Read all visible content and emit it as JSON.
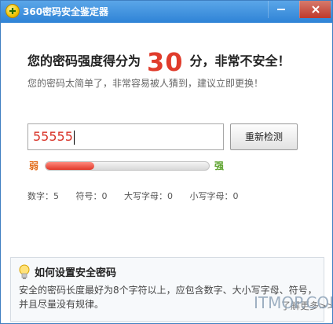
{
  "window": {
    "title": "360密码安全鉴定器"
  },
  "score": {
    "prefix": "您的密码强度得分为",
    "value": "30",
    "suffix": "分，非常不安全！",
    "subtitle": "您的密码太简单了，非常容易被人猜到，建议立即更换！"
  },
  "input": {
    "value": "55555"
  },
  "recheck_button": "重新检测",
  "strength": {
    "weak_label": "弱",
    "strong_label": "强",
    "level": 0.3,
    "fill_color": "#e0382a"
  },
  "stats": [
    {
      "label": "数字：5"
    },
    {
      "label": "符号：0"
    },
    {
      "label": "大写字母：0"
    },
    {
      "label": "小写字母：0"
    }
  ],
  "tip": {
    "title": "如何设置安全密码",
    "body": "安全的密码长度最好为8个字符以上，应包含数字、大小写字母、符号，并且尽量没有规律。",
    "more": "了解更多>>"
  },
  "watermark": "ITMOP.COM",
  "icons": {
    "app": "360-logo-icon",
    "minimize": "minimize-icon",
    "close": "close-icon",
    "tip": "lightbulb-icon"
  },
  "colors": {
    "titlebar": "#2f83d6",
    "score": "#e03c2c",
    "weak": "#e36f1e",
    "strong": "#5aa12a"
  }
}
